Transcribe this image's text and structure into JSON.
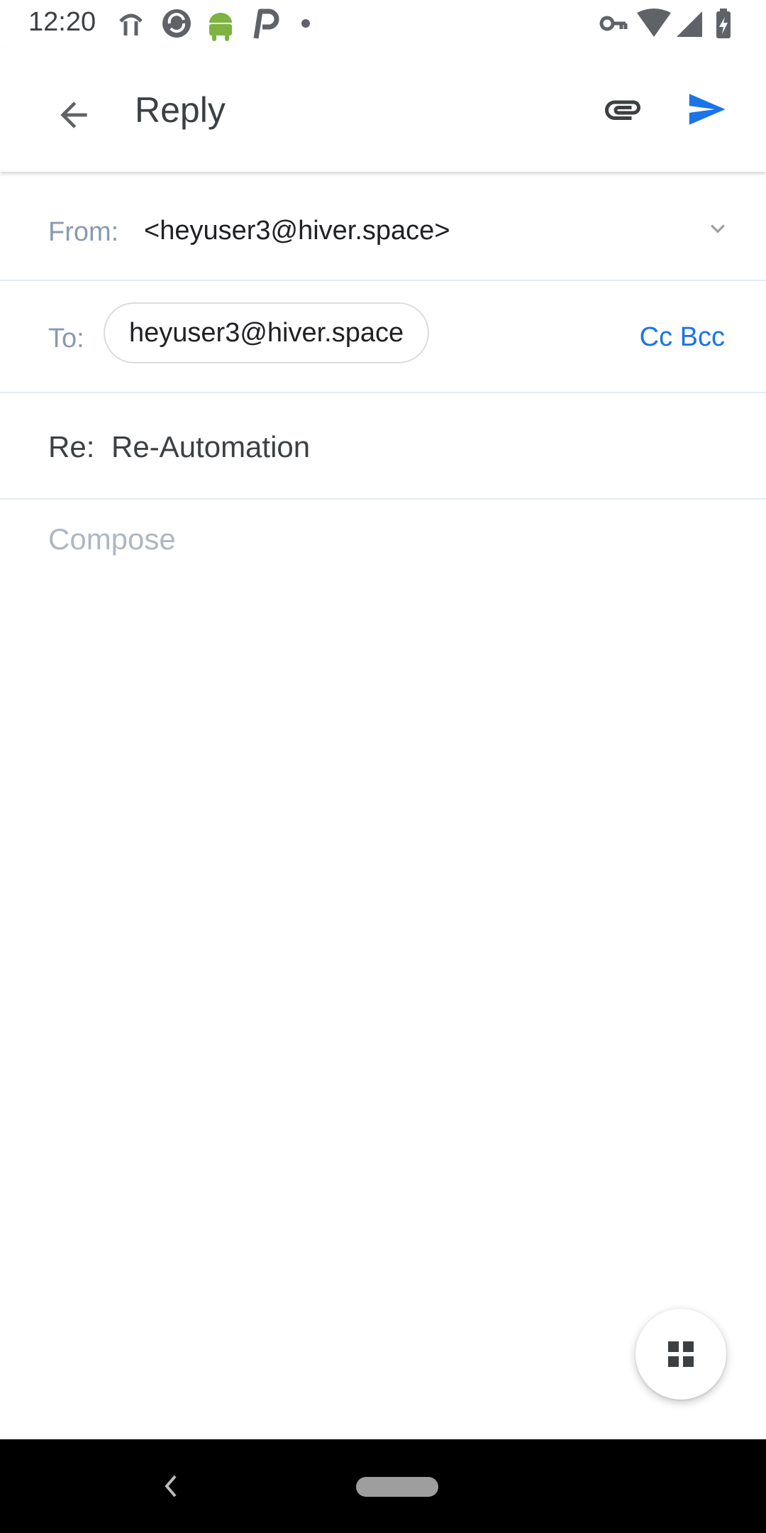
{
  "status_bar": {
    "time": "12:20",
    "left_icons": [
      "fitness-icon",
      "sync-icon",
      "android-icon",
      "p-app-icon",
      "dot-icon"
    ],
    "right_icons": [
      "vpn-key-icon",
      "wifi-icon",
      "signal-icon",
      "battery-charging-icon"
    ]
  },
  "app_bar": {
    "title": "Reply",
    "back_icon": "arrow-back-icon",
    "attach_icon": "paperclip-icon",
    "send_icon": "send-icon"
  },
  "from": {
    "label": "From:",
    "value": "<heyuser3@hiver.space>"
  },
  "to": {
    "label": "To:",
    "chip": "heyuser3@hiver.space",
    "cc_bcc": "Cc Bcc"
  },
  "subject": {
    "label": "Re:",
    "value": "Re-Automation"
  },
  "body": {
    "placeholder": "Compose"
  },
  "fab": {
    "icon": "grid-icon"
  },
  "colors": {
    "accent": "#1a73e8",
    "label_gray": "#8a9aaf",
    "divider": "#e3ebf5"
  }
}
